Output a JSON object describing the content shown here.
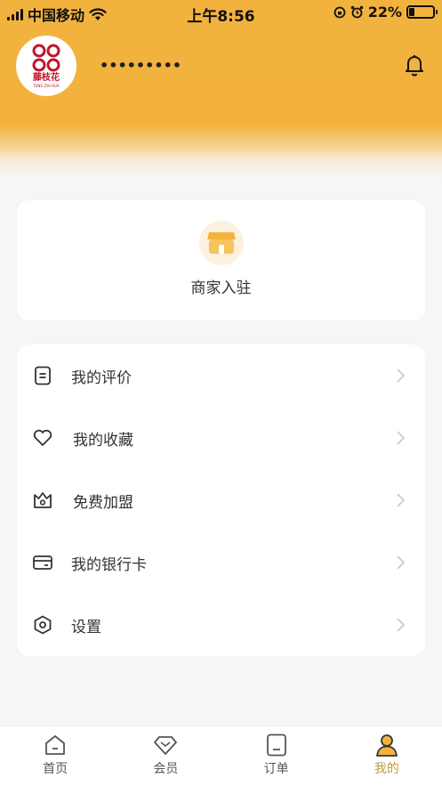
{
  "status_bar": {
    "carrier": "中国移动",
    "time": "上午8:56",
    "battery": "22%",
    "battery_level": 0.22
  },
  "profile": {
    "logo_text": "藤枝花",
    "logo_subtext": "TENG ZHI HUA",
    "username": "•••••••••",
    "notification_icon": "bell-icon"
  },
  "merchant": {
    "label": "商家入驻",
    "icon": "store-icon"
  },
  "menu": {
    "items": [
      {
        "label": "我的评价",
        "icon": "review-icon"
      },
      {
        "label": "我的收藏",
        "icon": "heart-icon"
      },
      {
        "label": "免费加盟",
        "icon": "crown-icon"
      },
      {
        "label": "我的银行卡",
        "icon": "bank-card-icon"
      },
      {
        "label": "设置",
        "icon": "settings-icon"
      }
    ]
  },
  "tabbar": {
    "tabs": [
      {
        "label": "首页",
        "icon": "home-icon"
      },
      {
        "label": "会员",
        "icon": "diamond-icon"
      },
      {
        "label": "订单",
        "icon": "order-icon"
      },
      {
        "label": "我的",
        "icon": "user-icon"
      }
    ],
    "active_index": 3
  },
  "colors": {
    "header": "#f2b33e",
    "accent": "#c59a3f",
    "logo": "#c0172d"
  }
}
